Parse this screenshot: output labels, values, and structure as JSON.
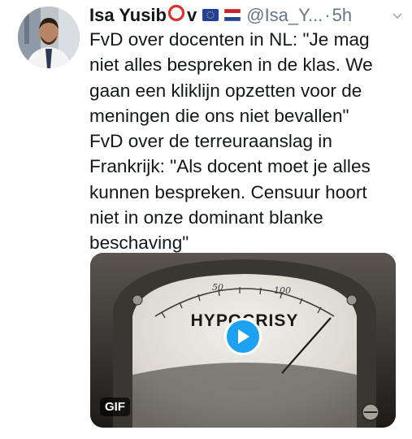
{
  "tweet": {
    "author_name": "Isa Yusib",
    "author_name_suffix": "v",
    "handle": "@Isa_Y...",
    "separator": "·",
    "time": "5h",
    "text_lines": [
      "FvD over docenten in NL: \"Je mag",
      "niet alles bespreken in de klas. We",
      "gaan een kliklijn opzetten voor de",
      "meningen die ons niet bevallen\"",
      "FvD over de terreuraanslag in",
      "Frankrijk: \"Als docent moet je alles",
      "kunnen bespreken. Censuur hoort",
      "niet in onze dominant blanke",
      "beschaving\""
    ],
    "icons": {
      "name_emoji": "red-circle-icon",
      "flag1": "eu-flag-icon",
      "flag2": "netherlands-flag-icon",
      "menu": "chevron-down-icon",
      "play": "play-icon"
    }
  },
  "media": {
    "badge": "GIF",
    "meter_label": "HYPOCRISY",
    "scale_labels": [
      "50",
      "100"
    ],
    "colors": {
      "play_button": "#1da1f2",
      "ring": "#e0302a"
    }
  }
}
